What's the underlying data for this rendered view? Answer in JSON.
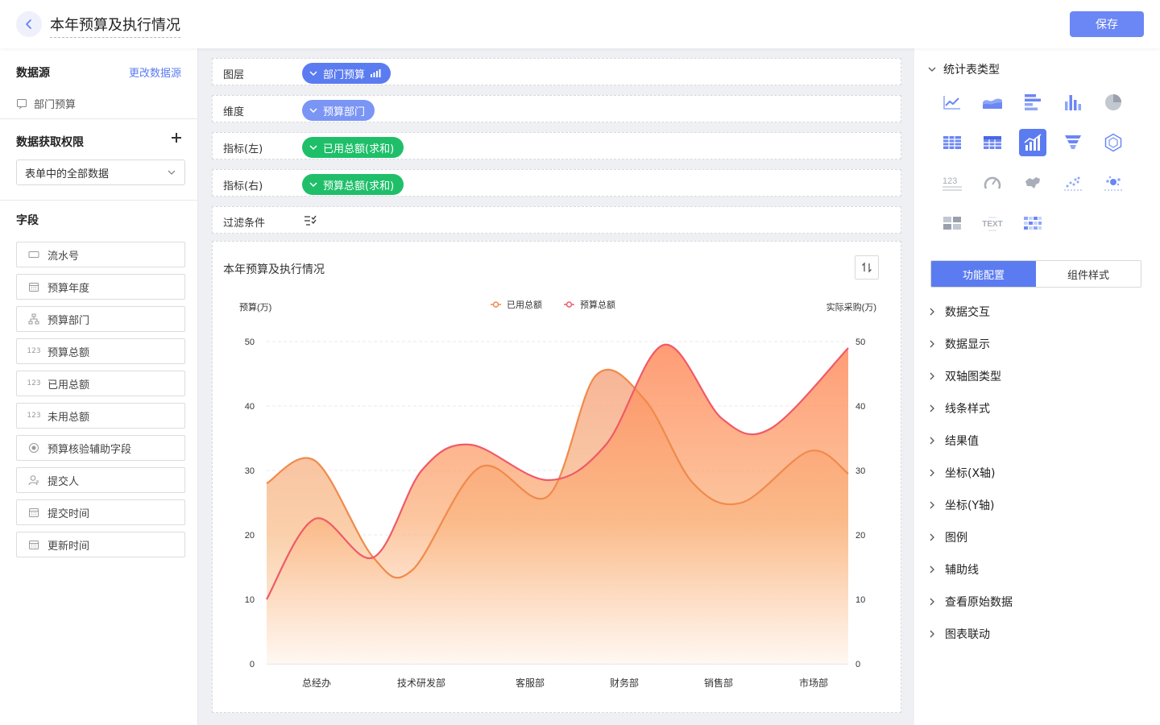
{
  "header": {
    "title": "本年预算及执行情况",
    "save_label": "保存"
  },
  "left": {
    "datasource_title": "数据源",
    "change_datasource": "更改数据源",
    "datasource_name": "部门预算",
    "permission_title": "数据获取权限",
    "permission_value": "表单中的全部数据",
    "fields_title": "字段",
    "fields": [
      {
        "label": "流水号",
        "icon": "text-field-icon"
      },
      {
        "label": "预算年度",
        "icon": "calendar-icon"
      },
      {
        "label": "预算部门",
        "icon": "org-tree-icon"
      },
      {
        "label": "预算总额",
        "icon": "number-icon"
      },
      {
        "label": "已用总额",
        "icon": "number-icon"
      },
      {
        "label": "未用总额",
        "icon": "number-icon"
      },
      {
        "label": "预算核验辅助字段",
        "icon": "radio-icon"
      },
      {
        "label": "提交人",
        "icon": "user-icon"
      },
      {
        "label": "提交时间",
        "icon": "calendar-icon"
      },
      {
        "label": "更新时间",
        "icon": "calendar-icon"
      }
    ]
  },
  "config": {
    "layer_label": "图层",
    "layer_value": "部门预算",
    "dimension_label": "维度",
    "dimension_value": "预算部门",
    "metric_left_label": "指标(左)",
    "metric_left_value": "已用总额(求和)",
    "metric_right_label": "指标(右)",
    "metric_right_value": "预算总额(求和)",
    "filter_label": "过滤条件"
  },
  "chart_data": {
    "type": "area",
    "title": "本年预算及执行情况",
    "ylabel_left": "预算(万)",
    "ylabel_right": "实际采购(万)",
    "categories": [
      "总经办",
      "技术研发部",
      "客服部",
      "财务部",
      "销售部",
      "市场部"
    ],
    "yticks": [
      0,
      10,
      20,
      30,
      40,
      50
    ],
    "ylim": [
      0,
      50
    ],
    "series": [
      {
        "name": "已用总额",
        "color": "#f08a4b",
        "axis": "left",
        "x": [
          0,
          0.5,
          1.1,
          1.5,
          2.2,
          2.9,
          3.4,
          3.9,
          4.4,
          4.9,
          5.6,
          6.0
        ],
        "values": [
          28,
          31.5,
          16.5,
          14.5,
          30.5,
          26,
          44.8,
          41,
          28,
          25,
          33,
          29.5
        ]
      },
      {
        "name": "预算总额",
        "color": "#ef5a68",
        "axis": "right",
        "x": [
          0,
          0.5,
          1.1,
          1.6,
          2.1,
          2.9,
          3.5,
          4.1,
          4.7,
          5.2,
          6.0
        ],
        "values": [
          10,
          22.5,
          16.5,
          30,
          34,
          28.5,
          34,
          49.5,
          38,
          36.5,
          49
        ]
      }
    ],
    "legend": "top-center",
    "grid": true
  },
  "right": {
    "chart_type_title": "统计表类型",
    "chart_types": [
      "line-chart-icon",
      "area-chart-icon",
      "bar-chart-icon",
      "column-chart-icon",
      "pie-chart-icon",
      "table-icon",
      "pivot-table-icon",
      "dual-axis-chart-icon",
      "funnel-chart-icon",
      "radar-chart-icon",
      "number-card-icon",
      "gauge-icon",
      "map-chart-icon",
      "scatter-chart-icon",
      "bubble-chart-icon",
      "layout-card-icon",
      "text-card-icon",
      "heatmap-icon"
    ],
    "active_type_index": 7,
    "text_card_label": "TEXT",
    "tab_function": "功能配置",
    "tab_style": "组件样式",
    "config_items": [
      "数据交互",
      "数据显示",
      "双轴图类型",
      "线条样式",
      "结果值",
      "坐标(X轴)",
      "坐标(Y轴)",
      "图例",
      "辅助线",
      "查看原始数据",
      "图表联动"
    ]
  }
}
